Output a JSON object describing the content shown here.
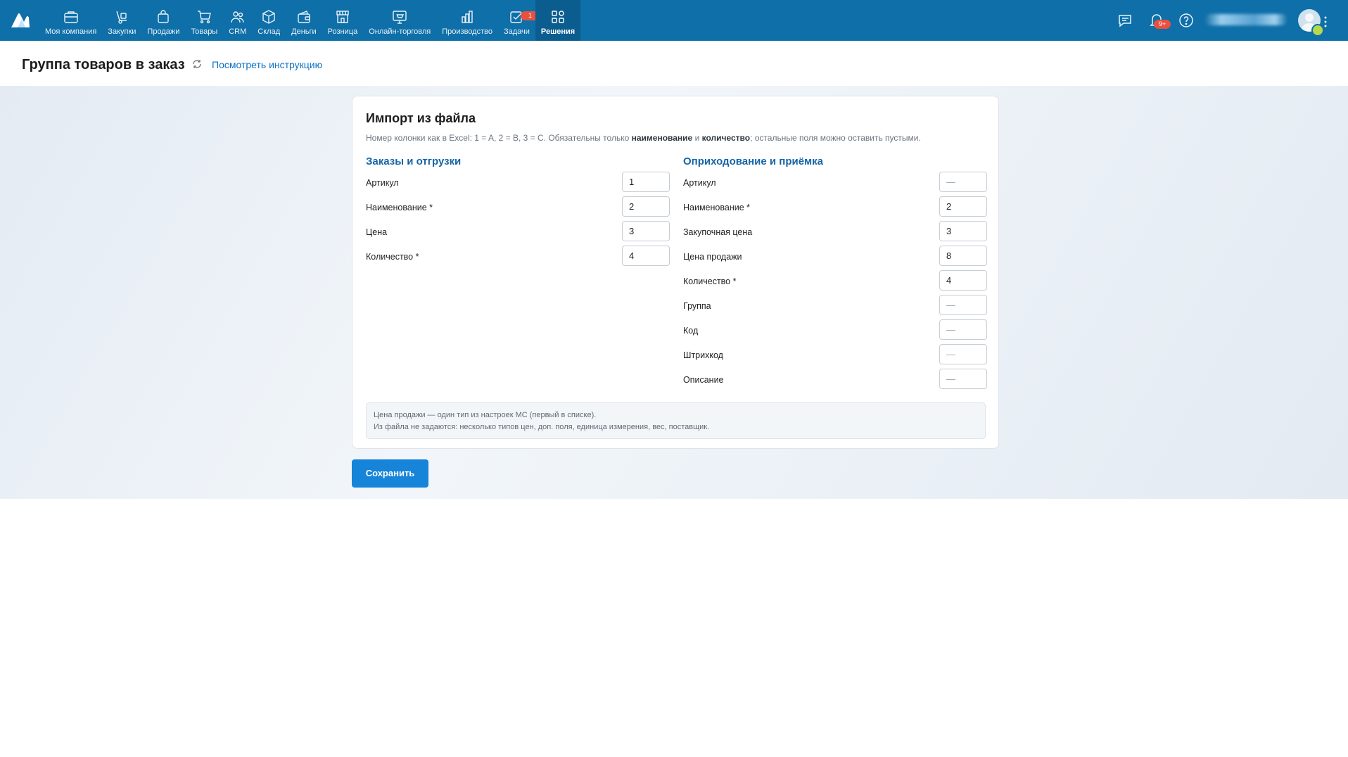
{
  "nav": {
    "items": [
      {
        "label": "Моя компания",
        "icon": "briefcase-icon"
      },
      {
        "label": "Закупки",
        "icon": "dolly-icon"
      },
      {
        "label": "Продажи",
        "icon": "shopping-bag-icon"
      },
      {
        "label": "Товары",
        "icon": "cart-icon"
      },
      {
        "label": "CRM",
        "icon": "users-icon"
      },
      {
        "label": "Склад",
        "icon": "box-icon"
      },
      {
        "label": "Деньги",
        "icon": "wallet-icon"
      },
      {
        "label": "Розница",
        "icon": "storefront-icon"
      },
      {
        "label": "Онлайн-торговля",
        "icon": "online-store-icon"
      },
      {
        "label": "Производство",
        "icon": "bar-chart-icon"
      },
      {
        "label": "Задачи",
        "icon": "task-check-icon",
        "badge": "1"
      },
      {
        "label": "Решения",
        "icon": "apps-grid-icon",
        "active": true
      }
    ],
    "notifications_badge": "9+"
  },
  "header": {
    "title": "Группа товаров в заказ",
    "instruction_link": "Посмотреть инструкцию"
  },
  "card": {
    "title": "Импорт из файла",
    "desc_prefix": "Номер колонки как в Excel: 1 = A, 2 = B, 3 = C. Обязательны только ",
    "desc_bold1": "наименование",
    "desc_mid": " и ",
    "desc_bold2": "количество",
    "desc_suffix": "; остальные поля можно оставить пустыми.",
    "left": {
      "title": "Заказы и отгрузки",
      "fields": [
        {
          "label": "Артикул",
          "value": "1"
        },
        {
          "label": "Наименование *",
          "value": "2"
        },
        {
          "label": "Цена",
          "value": "3"
        },
        {
          "label": "Количество *",
          "value": "4"
        }
      ]
    },
    "right": {
      "title": "Оприходование и приёмка",
      "fields": [
        {
          "label": "Артикул",
          "value": "—"
        },
        {
          "label": "Наименование *",
          "value": "2"
        },
        {
          "label": "Закупочная цена",
          "value": "3"
        },
        {
          "label": "Цена продажи",
          "value": "8"
        },
        {
          "label": "Количество *",
          "value": "4"
        },
        {
          "label": "Группа",
          "value": "—"
        },
        {
          "label": "Код",
          "value": "—"
        },
        {
          "label": "Штрихкод",
          "value": "—"
        },
        {
          "label": "Описание",
          "value": "—"
        }
      ]
    },
    "note_line1": "Цена продажи — один тип из настроек МС (первый в списке).",
    "note_line2": "Из файла не задаются: несколько типов цен, доп. поля, единица измерения, вес, поставщик."
  },
  "actions": {
    "save_label": "Сохранить"
  },
  "colors": {
    "topbar": "#0f6fa8",
    "accent_link": "#0b72c4",
    "section_title": "#1664a6",
    "primary_button": "#1684d8",
    "badge": "#e8503f"
  }
}
